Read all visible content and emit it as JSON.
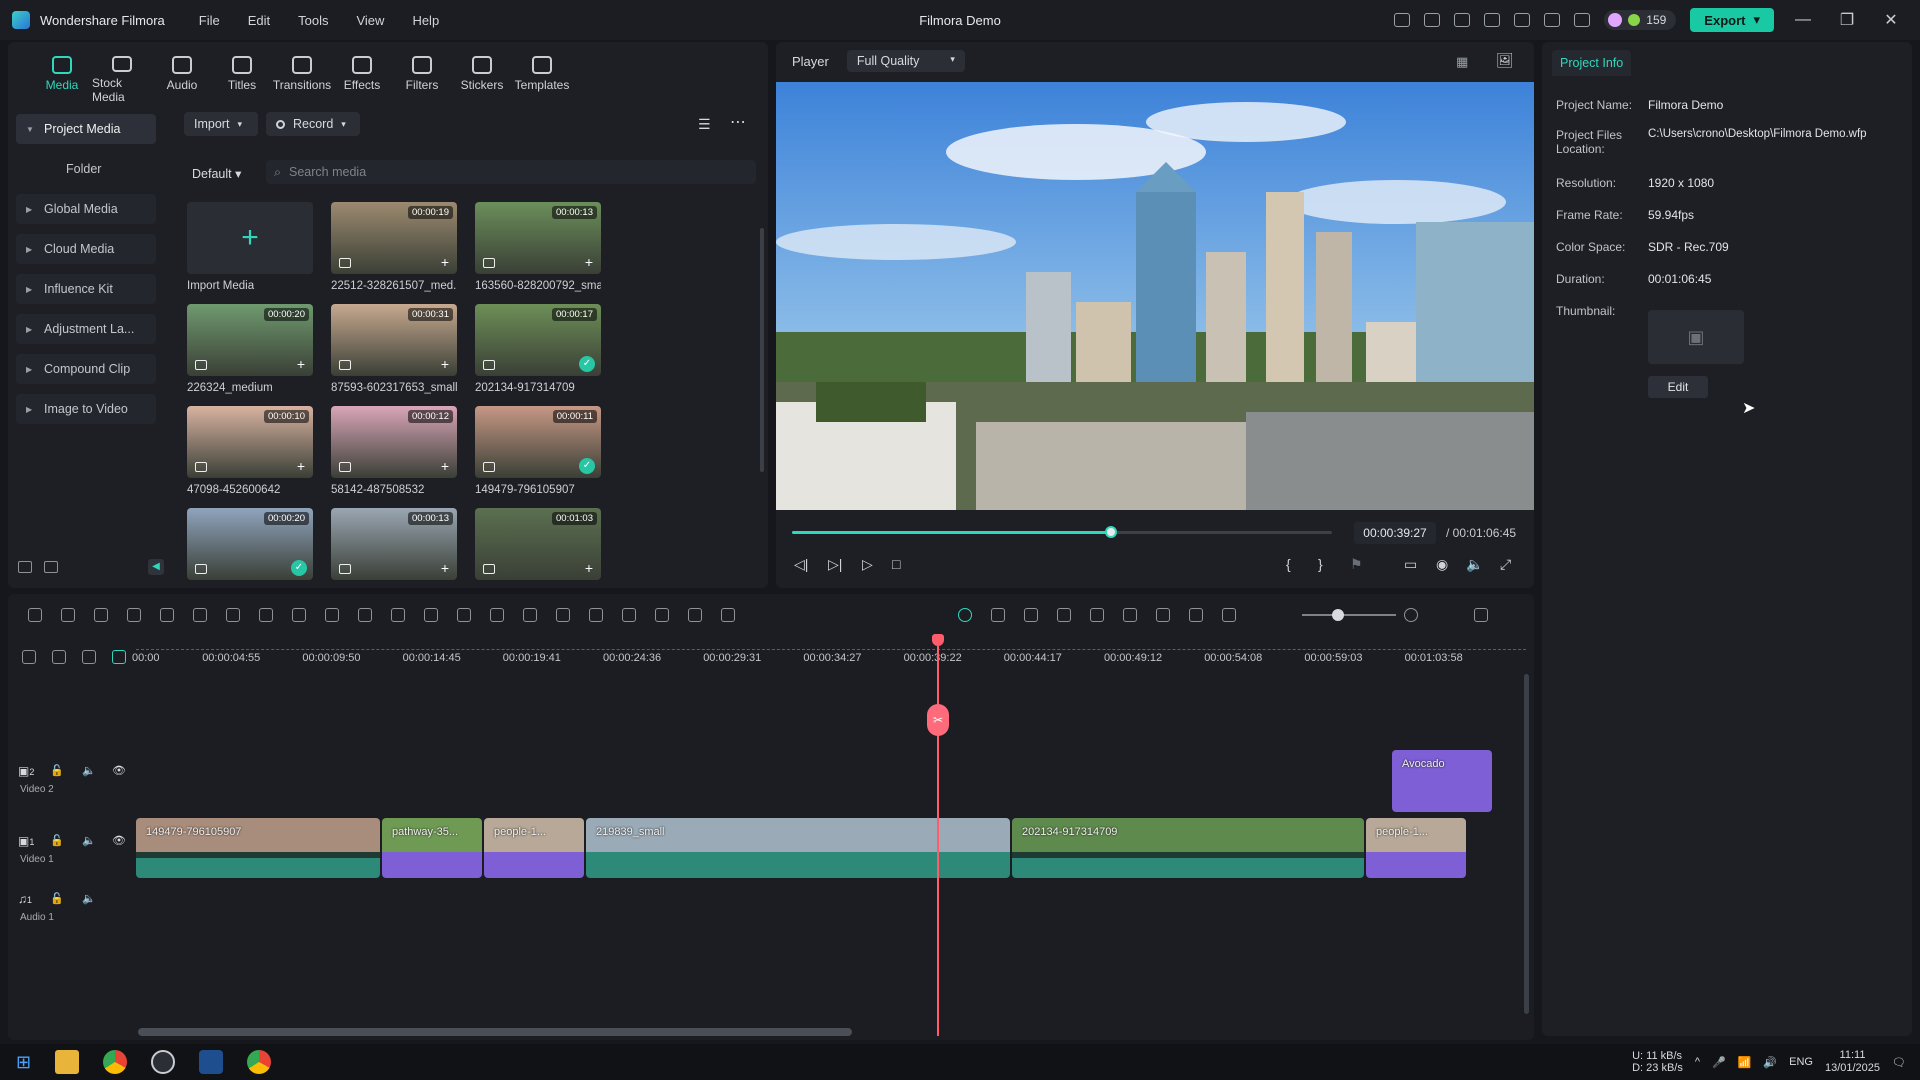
{
  "titlebar": {
    "app_name": "Wondershare Filmora",
    "menu": [
      "File",
      "Edit",
      "Tools",
      "View",
      "Help"
    ],
    "window_title": "Filmora Demo",
    "credits": "159",
    "export_label": "Export"
  },
  "toolbar": {
    "tabs": [
      "Media",
      "Stock Media",
      "Audio",
      "Titles",
      "Transitions",
      "Effects",
      "Filters",
      "Stickers",
      "Templates"
    ]
  },
  "sidebar": {
    "items": [
      "Project Media",
      "Folder",
      "Global Media",
      "Cloud Media",
      "Influence Kit",
      "Adjustment La...",
      "Compound Clip",
      "Image to Video"
    ]
  },
  "media": {
    "import_label": "Import",
    "record_label": "Record",
    "sort_label": "Default",
    "search_placeholder": "Search media",
    "import_media_label": "Import Media",
    "items": [
      {
        "name": "22512-328261507_med...",
        "duration": "00:00:19",
        "added": false
      },
      {
        "name": "163560-828200792_small",
        "duration": "00:00:13",
        "added": false
      },
      {
        "name": "226324_medium",
        "duration": "00:00:20",
        "added": false
      },
      {
        "name": "87593-602317653_small",
        "duration": "00:00:31",
        "added": false
      },
      {
        "name": "202134-917314709",
        "duration": "00:00:17",
        "added": true
      },
      {
        "name": "47098-452600642",
        "duration": "00:00:10",
        "added": false
      },
      {
        "name": "58142-487508532",
        "duration": "00:00:12",
        "added": false
      },
      {
        "name": "149479-796105907",
        "duration": "00:00:11",
        "added": true
      },
      {
        "name": "",
        "duration": "00:00:20",
        "added": true
      },
      {
        "name": "",
        "duration": "00:00:13",
        "added": false
      },
      {
        "name": "",
        "duration": "00:01:03",
        "added": false
      }
    ]
  },
  "player": {
    "label": "Player",
    "quality": "Full Quality",
    "current_time": "00:00:39:27",
    "total_time": "/ 00:01:06:45",
    "progress": 0.59
  },
  "project_info": {
    "tab": "Project Info",
    "rows": [
      {
        "key": "Project Name:",
        "value": "Filmora Demo"
      },
      {
        "key": "Project Files Location:",
        "value": "C:\\Users\\crono\\Desktop\\Filmora Demo.wfp"
      },
      {
        "key": "Resolution:",
        "value": "1920 x 1080"
      },
      {
        "key": "Frame Rate:",
        "value": "59.94fps"
      },
      {
        "key": "Color Space:",
        "value": "SDR - Rec.709"
      },
      {
        "key": "Duration:",
        "value": "00:01:06:45"
      },
      {
        "key": "Thumbnail:",
        "value": ""
      }
    ],
    "edit_label": "Edit"
  },
  "timeline": {
    "ruler": [
      "00:00",
      "00:00:04:55",
      "00:00:09:50",
      "00:00:14:45",
      "00:00:19:41",
      "00:00:24:36",
      "00:00:29:31",
      "00:00:34:27",
      "00:00:39:22",
      "00:00:44:17",
      "00:00:49:12",
      "00:00:54:08",
      "00:00:59:03",
      "00:01:03:58"
    ],
    "tracks": [
      {
        "label": "Video 2",
        "number": "2"
      },
      {
        "label": "Video 1",
        "number": "1"
      },
      {
        "label": "Audio 1",
        "number": "1"
      }
    ],
    "clips_v1": [
      "149479-796105907",
      "pathway-35...",
      "people-1...",
      "219839_small",
      "202134-917314709",
      "people-1..."
    ],
    "clips_v2": [
      "Avocado"
    ]
  },
  "taskbar": {
    "net_up": "11 kB/s",
    "net_down": "23 kB/s",
    "net_up_label": "U:",
    "net_down_label": "D:",
    "lang": "ENG",
    "time": "11:11",
    "date": "13/01/2025"
  },
  "colors": {
    "accent": "#2fd8bd",
    "playhead": "#ff5c6c",
    "clip_purple": "#7e5fd6",
    "clip_teal": "#2e8a78"
  }
}
